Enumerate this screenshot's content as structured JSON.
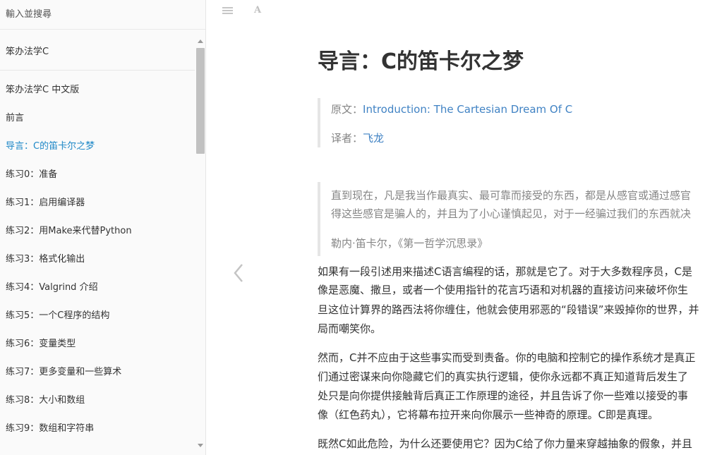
{
  "search": {
    "placeholder": "輸入並搜尋"
  },
  "toc": {
    "book_title": "笨办法学C",
    "items": [
      {
        "label": "笨办法学C 中文版",
        "active": false
      },
      {
        "label": "前言",
        "active": false
      },
      {
        "label": "导言：C的笛卡尔之梦",
        "active": true
      },
      {
        "label": "练习0：准备",
        "active": false
      },
      {
        "label": "练习1：启用编译器",
        "active": false
      },
      {
        "label": "练习2：用Make来代替Python",
        "active": false
      },
      {
        "label": "练习3：格式化输出",
        "active": false
      },
      {
        "label": "练习4：Valgrind 介绍",
        "active": false
      },
      {
        "label": "练习5：一个C程序的结构",
        "active": false
      },
      {
        "label": "练习6：变量类型",
        "active": false
      },
      {
        "label": "练习7：更多变量和一些算术",
        "active": false
      },
      {
        "label": "练习8：大小和数组",
        "active": false
      },
      {
        "label": "练习9：数组和字符串",
        "active": false
      }
    ]
  },
  "toolbar": {
    "font_label": "A",
    "menu_icon": "hamburger-icon",
    "font_icon": "font-settings-icon"
  },
  "article": {
    "title": "导言：C的笛卡尔之梦",
    "original_label": "原文：",
    "original_link": "Introduction: The Cartesian Dream Of C",
    "translator_label": "译者：",
    "translator_link": "飞龙",
    "quote_lines": [
      "直到现在，凡是我当作最真实、最可靠而接受的东西，都是从感官或通过感官",
      "得这些感官是骗人的，并且为了小心谨慎起见，对于一经骗过我们的东西就决"
    ],
    "quote_attribution": "勒内·笛卡尔，《第一哲学沉思录》",
    "paragraphs": [
      [
        "如果有一段引述用来描述C语言编程的话，那就是它了。对于大多数程序员，C是",
        "像是恶魔、撒旦，或者一个使用指针的花言巧语和对机器的直接访问来破坏你生",
        "旦这位计算界的路西法将你缠住，他就会使用邪恶的“段错误”来毁掉你的世界，并",
        "局而嘲笑你。"
      ],
      [
        "然而，C并不应由于这些事实而受到责备。你的电脑和控制它的操作系统才是真正",
        "们通过密谋来向你隐藏它们的真实执行逻辑，使你永远都不真正知道背后发生了",
        "处只是向你提供接触背后真正工作原理的途径，并且告诉了你一些难以接受的事",
        "像（红色药丸），它将幕布拉开来向你展示一些神奇的原理。C即是真理。"
      ],
      [
        "既然C如此危险，为什么还要使用它？因为C给了你力量来穿越抽象的假象，并且"
      ]
    ]
  },
  "colors": {
    "accent": "#1e88c7",
    "link": "#4183c4",
    "muted": "#858585"
  }
}
